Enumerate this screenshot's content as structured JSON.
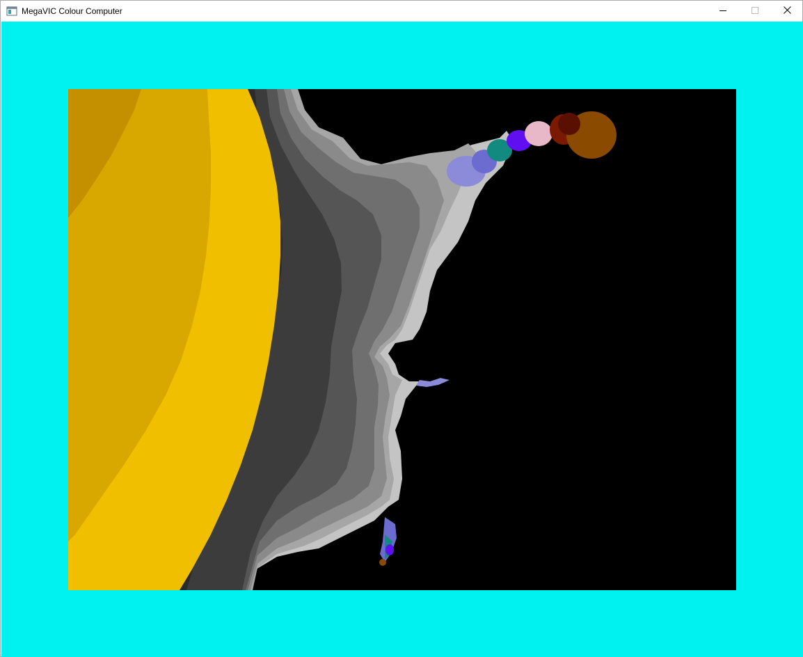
{
  "window": {
    "title": "MegaVIC Colour Computer",
    "icon": "app-window-icon",
    "controls": {
      "minimize_icon": "minimize-icon",
      "maximize_icon": "maximize-icon",
      "close_icon": "close-icon"
    }
  },
  "display": {
    "border_color": "#00f2f0",
    "background_color": "#000000",
    "render": "mandelbrot-fractal",
    "palette": [
      "#c49000",
      "#d8a800",
      "#f0c000",
      "#2a2a2a",
      "#3c3c3c",
      "#555555",
      "#6f6f6f",
      "#8a8a8a",
      "#a6a6a6",
      "#c4c4c4",
      "#8b8bd9",
      "#6b6bd0",
      "#138a80",
      "#6010f0",
      "#e8b8c8",
      "#7a1a00",
      "#8a4a00"
    ]
  }
}
